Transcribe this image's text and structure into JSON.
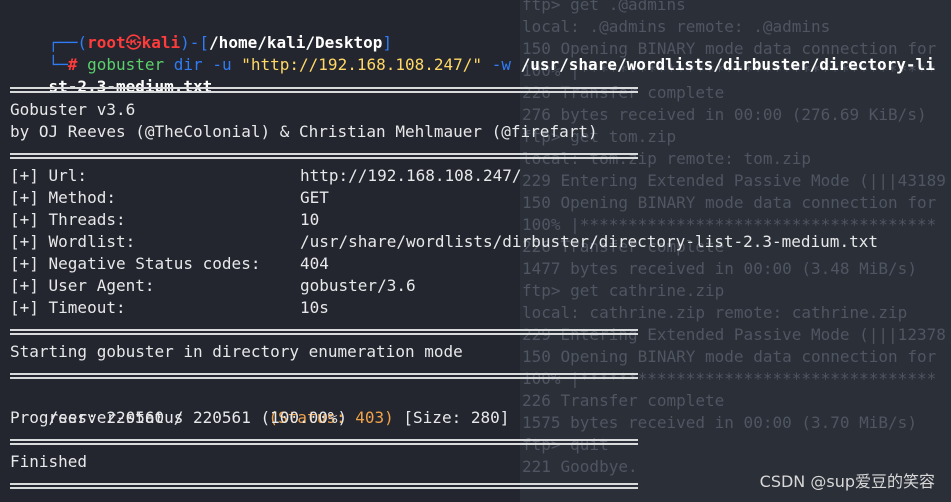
{
  "prompt": {
    "user": "root",
    "skull": "㉿",
    "host": "kali",
    "path": "/home/kali/Desktop",
    "hash": "#"
  },
  "command": {
    "program": "gobuster",
    "sub": "dir",
    "flag_u": "-u",
    "url": "\"http://192.168.108.247/\"",
    "flag_w": "-w",
    "wordlist_part1": "/usr/share/wordlists/dirbuster/directory-li",
    "wordlist_part2": "st-2.3-medium.txt"
  },
  "banner": {
    "version": "Gobuster v3.6",
    "authors": "by OJ Reeves (@TheColonial) & Christian Mehlmauer (@firefart)"
  },
  "config": [
    {
      "label": "[+] Url:",
      "value": "http://192.168.108.247/"
    },
    {
      "label": "[+] Method:",
      "value": "GET"
    },
    {
      "label": "[+] Threads:",
      "value": "10"
    },
    {
      "label": "[+] Wordlist:",
      "value": "/usr/share/wordlists/dirbuster/directory-list-2.3-medium.txt"
    },
    {
      "label": "[+] Negative Status codes:",
      "value": "404"
    },
    {
      "label": "[+] User Agent:",
      "value": "gobuster/3.6"
    },
    {
      "label": "[+] Timeout:",
      "value": "10s"
    }
  ],
  "run": {
    "start": "Starting gobuster in directory enumeration mode",
    "result_path": "/server-status",
    "result_status": "(Status: 403)",
    "result_size": "[Size: 280]",
    "progress": "Progress: 220560 / 220561 (100.00%)",
    "finished": "Finished"
  },
  "background_terminal": [
    "ftp> get .@admins",
    "local: .@admins remote: .@admins",
    "150 Opening BINARY mode data connection for",
    "100% |*************************************",
    "226 Transfer complete",
    "276 bytes received in 00:00 (276.69 KiB/s)",
    "ftp> get tom.zip",
    "local: tom.zip remote: tom.zip",
    "229 Entering Extended Passive Mode (|||43189",
    "150 Opening BINARY mode data connection for",
    "100% |*************************************",
    "226 Transfer complete",
    "1477 bytes received in 00:00 (3.48 MiB/s)",
    "ftp> get cathrine.zip",
    "local: cathrine.zip remote: cathrine.zip",
    "229 Entering Extended Passive Mode (|||12378",
    "150 Opening BINARY mode data connection for",
    "100% |*************************************",
    "226 Transfer complete",
    "1575 bytes received in 00:00 (3.70 MiB/s)",
    "ftp> quit",
    "221 Goodbye."
  ],
  "watermark": "CSDN @sup爱豆的笑容"
}
